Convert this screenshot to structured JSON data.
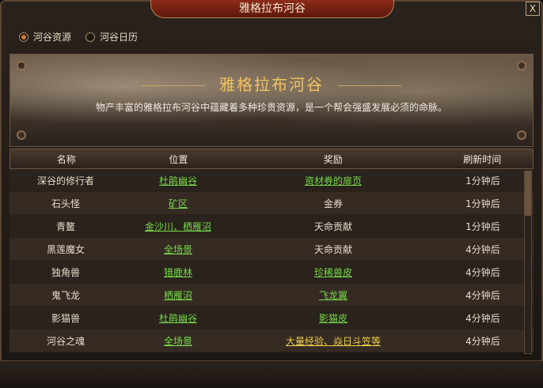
{
  "window": {
    "title": "雅格拉布河谷",
    "close_label": "X"
  },
  "tabs": [
    {
      "label": "河谷资源",
      "selected": true
    },
    {
      "label": "河谷日历",
      "selected": false
    }
  ],
  "banner": {
    "title": "雅格拉布河谷",
    "description": "物产丰富的雅格拉布河谷中蕴藏着多种珍贵资源，是一个帮会强盛发展必须的命脉。"
  },
  "table": {
    "headers": [
      "名称",
      "位置",
      "奖励",
      "刷新时间"
    ],
    "rows": [
      {
        "name": "深谷的修行者",
        "location": "杜鹃幽谷",
        "reward": "资材券的扉页",
        "refresh": "1分钟后"
      },
      {
        "name": "石头怪",
        "location": "矿区",
        "reward": "金券",
        "refresh": "1分钟后"
      },
      {
        "name": "青鳌",
        "location": "金沙川、栖雁沼",
        "reward": "天命贡献",
        "refresh": "1分钟后"
      },
      {
        "name": "黑莲魔女",
        "location": "全场景",
        "reward": "天命贡献",
        "refresh": "4分钟后"
      },
      {
        "name": "独角兽",
        "location": "猎鹿林",
        "reward": "珍稀兽皮",
        "refresh": "4分钟后"
      },
      {
        "name": "鬼飞龙",
        "location": "栖雁沼",
        "reward": "飞龙翼",
        "refresh": "4分钟后"
      },
      {
        "name": "影猫兽",
        "location": "杜鹃幽谷",
        "reward": "影猫皮",
        "refresh": "4分钟后"
      },
      {
        "name": "河谷之魂",
        "location": "全场景",
        "reward": "大量经验、焱日斗笠等",
        "refresh": "4分钟后"
      }
    ]
  },
  "colors": {
    "link": "#76d84a",
    "gold": "#f0cf49",
    "accent": "#f3c35e"
  }
}
